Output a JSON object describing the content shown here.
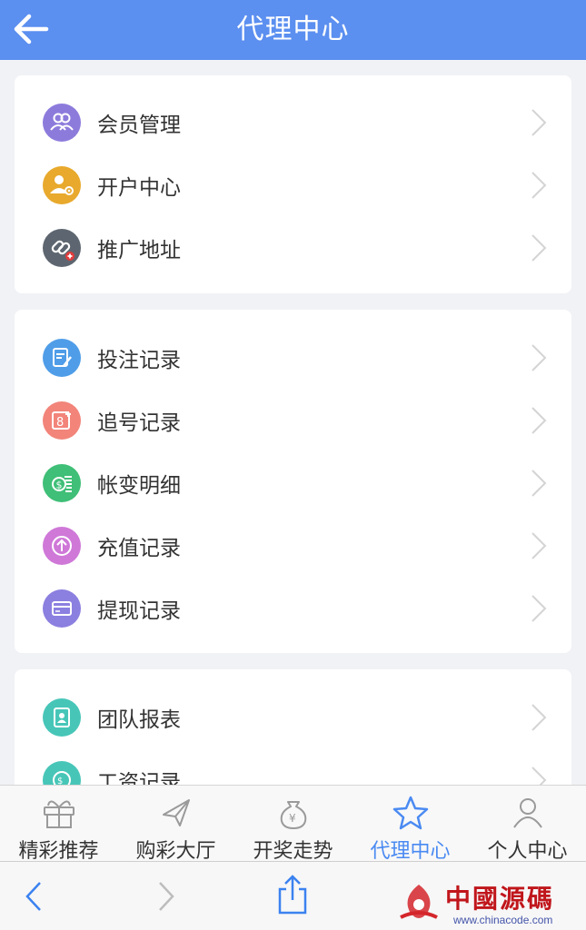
{
  "header": {
    "title": "代理中心"
  },
  "groups": [
    {
      "items": [
        {
          "label": "会员管理",
          "icon": "members-icon",
          "color": "#8d7bdc"
        },
        {
          "label": "开户中心",
          "icon": "add-user-icon",
          "color": "#e8a92c"
        },
        {
          "label": "推广地址",
          "icon": "link-icon",
          "color": "#5d6670"
        }
      ]
    },
    {
      "items": [
        {
          "label": "投注记录",
          "icon": "edit-icon",
          "color": "#4f9de8"
        },
        {
          "label": "追号记录",
          "icon": "number-plus-icon",
          "color": "#f2847a"
        },
        {
          "label": "帐变明细",
          "icon": "money-icon",
          "color": "#3fbf77"
        },
        {
          "label": "充值记录",
          "icon": "up-arrow-icon",
          "color": "#cf78d8"
        },
        {
          "label": "提现记录",
          "icon": "card-icon",
          "color": "#8b7fe0"
        }
      ]
    },
    {
      "items": [
        {
          "label": "团队报表",
          "icon": "report-icon",
          "color": "#47c6b8"
        },
        {
          "label": "工资记录",
          "icon": "salary-icon",
          "color": "#47c6b8"
        }
      ]
    }
  ],
  "tabs": [
    {
      "label": "精彩推荐",
      "icon": "gift-icon",
      "active": false
    },
    {
      "label": "购彩大厅",
      "icon": "plane-icon",
      "active": false
    },
    {
      "label": "开奖走势",
      "icon": "money-bag-icon",
      "active": false
    },
    {
      "label": "代理中心",
      "icon": "star-icon",
      "active": true
    },
    {
      "label": "个人中心",
      "icon": "person-icon",
      "active": false
    }
  ],
  "watermark": {
    "text": "中國源碼",
    "url": "www.chinacode.com"
  },
  "colors": {
    "header": "#5b8ff0",
    "active_tab": "#4a8af2"
  }
}
